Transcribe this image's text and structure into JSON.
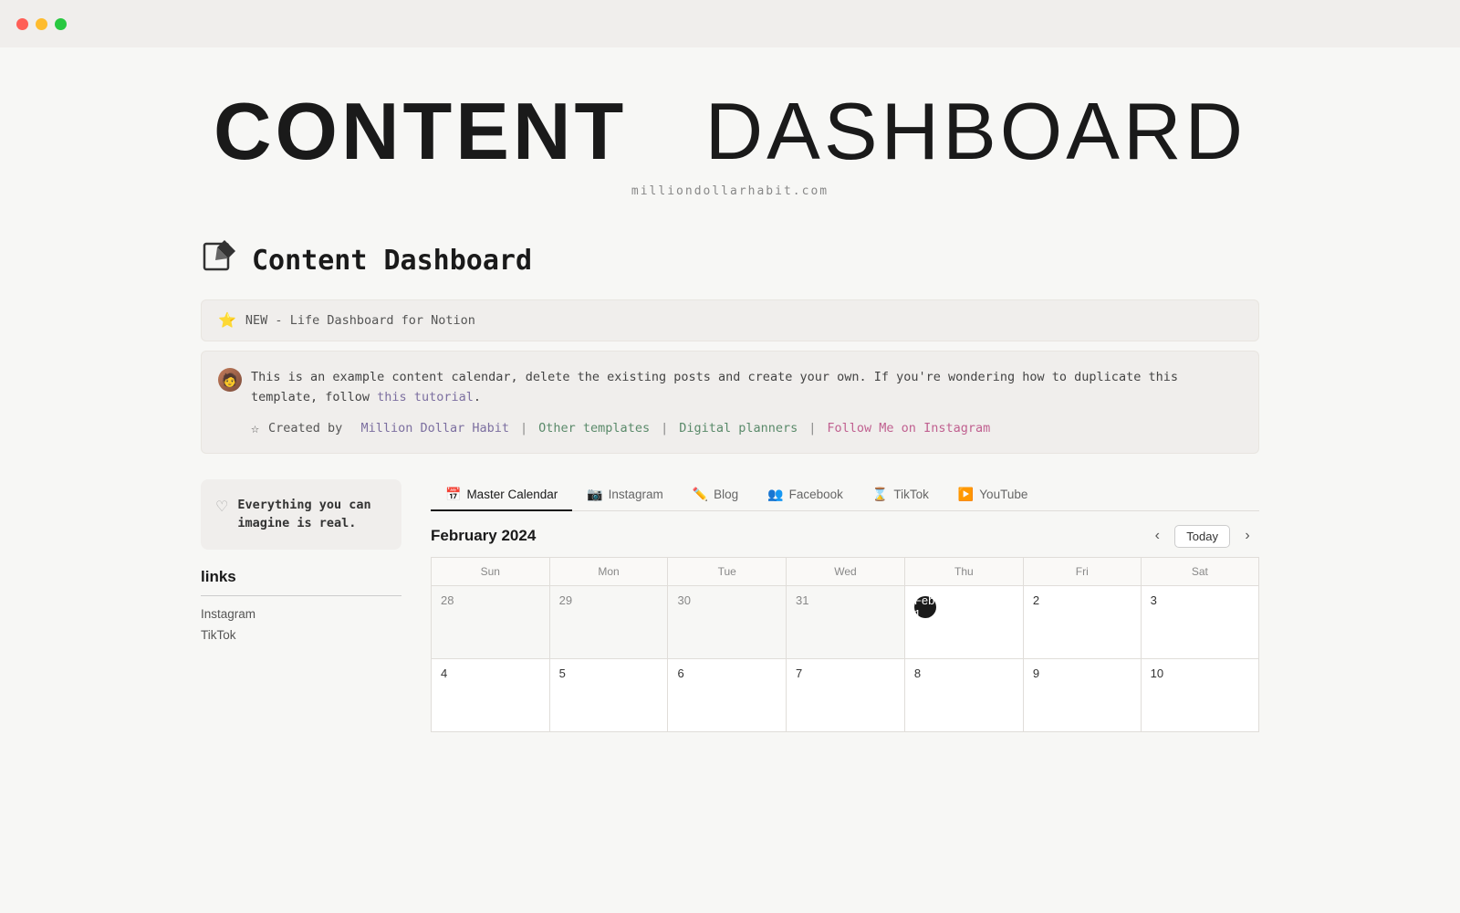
{
  "titlebar": {
    "buttons": [
      "close",
      "minimize",
      "maximize"
    ]
  },
  "hero": {
    "title_bold": "CONTENT",
    "title_light": "DASHBOARD",
    "subtitle": "milliondollarhabit.com"
  },
  "page": {
    "icon": "✏️",
    "title": "Content Dashboard"
  },
  "notice": {
    "icon": "⭐",
    "text": "NEW - Life Dashboard for Notion",
    "link": "Life Dashboard for Notion",
    "link_href": "#"
  },
  "info": {
    "main_text": "This is an example content calendar, delete the existing posts and create your own. If you're wondering how to duplicate this template, follow ",
    "tutorial_link_text": "this tutorial",
    "tutorial_link_href": "#",
    "links": [
      {
        "label": "Million Dollar Habit",
        "href": "#",
        "color": "purple"
      },
      {
        "sep": "|"
      },
      {
        "label": "Other templates",
        "href": "#",
        "color": "green"
      },
      {
        "sep": "|"
      },
      {
        "label": "Digital planners",
        "href": "#",
        "color": "green"
      },
      {
        "sep": "|"
      },
      {
        "label": "Follow Me on Instagram",
        "href": "#",
        "color": "pink"
      }
    ],
    "created_by_label": "Created by"
  },
  "sidebar": {
    "quote": "Everything you can imagine is real.",
    "links_title": "links",
    "links": [
      {
        "label": "Instagram"
      },
      {
        "label": "TikTok"
      }
    ]
  },
  "tabs": [
    {
      "id": "master",
      "icon": "📅",
      "label": "Master Calendar",
      "active": true
    },
    {
      "id": "instagram",
      "icon": "📷",
      "label": "Instagram",
      "active": false
    },
    {
      "id": "blog",
      "icon": "✏️",
      "label": "Blog",
      "active": false
    },
    {
      "id": "facebook",
      "icon": "👥",
      "label": "Facebook",
      "active": false
    },
    {
      "id": "tiktok",
      "icon": "⌛",
      "label": "TikTok",
      "active": false
    },
    {
      "id": "youtube",
      "icon": "▶️",
      "label": "YouTube",
      "active": false
    }
  ],
  "calendar": {
    "month_label": "February 2024",
    "today_label": "Today",
    "nav_prev": "‹",
    "nav_next": "›",
    "day_headers": [
      "Sun",
      "Mon",
      "Tue",
      "Wed",
      "Thu",
      "Fri",
      "Sat"
    ],
    "weeks": [
      [
        {
          "num": "28",
          "current": false
        },
        {
          "num": "29",
          "current": false
        },
        {
          "num": "30",
          "current": false
        },
        {
          "num": "31",
          "current": false
        },
        {
          "num": "Feb 1",
          "current": true,
          "today": true
        },
        {
          "num": "2",
          "current": true
        },
        {
          "num": "3",
          "current": true
        }
      ]
    ]
  }
}
